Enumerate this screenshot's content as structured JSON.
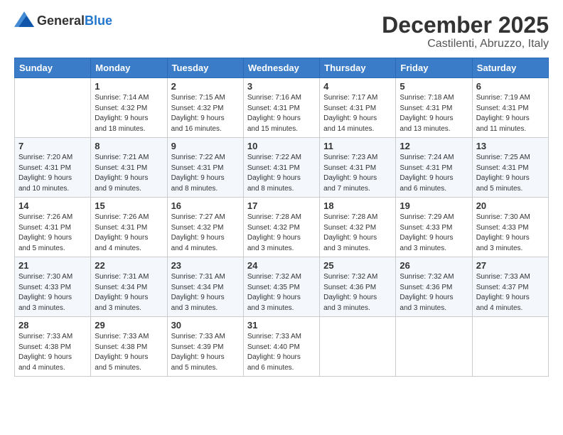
{
  "header": {
    "logo_general": "General",
    "logo_blue": "Blue",
    "month": "December 2025",
    "location": "Castilenti, Abruzzo, Italy"
  },
  "days_of_week": [
    "Sunday",
    "Monday",
    "Tuesday",
    "Wednesday",
    "Thursday",
    "Friday",
    "Saturday"
  ],
  "weeks": [
    [
      {
        "day": "",
        "info": ""
      },
      {
        "day": "1",
        "info": "Sunrise: 7:14 AM\nSunset: 4:32 PM\nDaylight: 9 hours\nand 18 minutes."
      },
      {
        "day": "2",
        "info": "Sunrise: 7:15 AM\nSunset: 4:32 PM\nDaylight: 9 hours\nand 16 minutes."
      },
      {
        "day": "3",
        "info": "Sunrise: 7:16 AM\nSunset: 4:31 PM\nDaylight: 9 hours\nand 15 minutes."
      },
      {
        "day": "4",
        "info": "Sunrise: 7:17 AM\nSunset: 4:31 PM\nDaylight: 9 hours\nand 14 minutes."
      },
      {
        "day": "5",
        "info": "Sunrise: 7:18 AM\nSunset: 4:31 PM\nDaylight: 9 hours\nand 13 minutes."
      },
      {
        "day": "6",
        "info": "Sunrise: 7:19 AM\nSunset: 4:31 PM\nDaylight: 9 hours\nand 11 minutes."
      }
    ],
    [
      {
        "day": "7",
        "info": "Sunrise: 7:20 AM\nSunset: 4:31 PM\nDaylight: 9 hours\nand 10 minutes."
      },
      {
        "day": "8",
        "info": "Sunrise: 7:21 AM\nSunset: 4:31 PM\nDaylight: 9 hours\nand 9 minutes."
      },
      {
        "day": "9",
        "info": "Sunrise: 7:22 AM\nSunset: 4:31 PM\nDaylight: 9 hours\nand 8 minutes."
      },
      {
        "day": "10",
        "info": "Sunrise: 7:22 AM\nSunset: 4:31 PM\nDaylight: 9 hours\nand 8 minutes."
      },
      {
        "day": "11",
        "info": "Sunrise: 7:23 AM\nSunset: 4:31 PM\nDaylight: 9 hours\nand 7 minutes."
      },
      {
        "day": "12",
        "info": "Sunrise: 7:24 AM\nSunset: 4:31 PM\nDaylight: 9 hours\nand 6 minutes."
      },
      {
        "day": "13",
        "info": "Sunrise: 7:25 AM\nSunset: 4:31 PM\nDaylight: 9 hours\nand 5 minutes."
      }
    ],
    [
      {
        "day": "14",
        "info": "Sunrise: 7:26 AM\nSunset: 4:31 PM\nDaylight: 9 hours\nand 5 minutes."
      },
      {
        "day": "15",
        "info": "Sunrise: 7:26 AM\nSunset: 4:31 PM\nDaylight: 9 hours\nand 4 minutes."
      },
      {
        "day": "16",
        "info": "Sunrise: 7:27 AM\nSunset: 4:32 PM\nDaylight: 9 hours\nand 4 minutes."
      },
      {
        "day": "17",
        "info": "Sunrise: 7:28 AM\nSunset: 4:32 PM\nDaylight: 9 hours\nand 3 minutes."
      },
      {
        "day": "18",
        "info": "Sunrise: 7:28 AM\nSunset: 4:32 PM\nDaylight: 9 hours\nand 3 minutes."
      },
      {
        "day": "19",
        "info": "Sunrise: 7:29 AM\nSunset: 4:33 PM\nDaylight: 9 hours\nand 3 minutes."
      },
      {
        "day": "20",
        "info": "Sunrise: 7:30 AM\nSunset: 4:33 PM\nDaylight: 9 hours\nand 3 minutes."
      }
    ],
    [
      {
        "day": "21",
        "info": "Sunrise: 7:30 AM\nSunset: 4:33 PM\nDaylight: 9 hours\nand 3 minutes."
      },
      {
        "day": "22",
        "info": "Sunrise: 7:31 AM\nSunset: 4:34 PM\nDaylight: 9 hours\nand 3 minutes."
      },
      {
        "day": "23",
        "info": "Sunrise: 7:31 AM\nSunset: 4:34 PM\nDaylight: 9 hours\nand 3 minutes."
      },
      {
        "day": "24",
        "info": "Sunrise: 7:32 AM\nSunset: 4:35 PM\nDaylight: 9 hours\nand 3 minutes."
      },
      {
        "day": "25",
        "info": "Sunrise: 7:32 AM\nSunset: 4:36 PM\nDaylight: 9 hours\nand 3 minutes."
      },
      {
        "day": "26",
        "info": "Sunrise: 7:32 AM\nSunset: 4:36 PM\nDaylight: 9 hours\nand 3 minutes."
      },
      {
        "day": "27",
        "info": "Sunrise: 7:33 AM\nSunset: 4:37 PM\nDaylight: 9 hours\nand 4 minutes."
      }
    ],
    [
      {
        "day": "28",
        "info": "Sunrise: 7:33 AM\nSunset: 4:38 PM\nDaylight: 9 hours\nand 4 minutes."
      },
      {
        "day": "29",
        "info": "Sunrise: 7:33 AM\nSunset: 4:38 PM\nDaylight: 9 hours\nand 5 minutes."
      },
      {
        "day": "30",
        "info": "Sunrise: 7:33 AM\nSunset: 4:39 PM\nDaylight: 9 hours\nand 5 minutes."
      },
      {
        "day": "31",
        "info": "Sunrise: 7:33 AM\nSunset: 4:40 PM\nDaylight: 9 hours\nand 6 minutes."
      },
      {
        "day": "",
        "info": ""
      },
      {
        "day": "",
        "info": ""
      },
      {
        "day": "",
        "info": ""
      }
    ]
  ]
}
